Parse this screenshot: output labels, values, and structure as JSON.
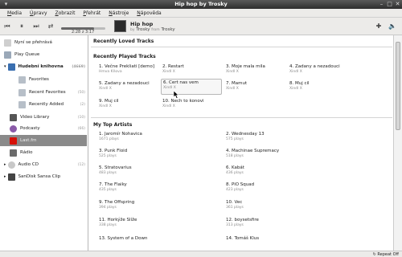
{
  "window": {
    "title": "Hip hop by Trosky"
  },
  "menu": [
    "Media",
    "Úpravy",
    "Zobrazit",
    "Přehrát",
    "Nástroje",
    "Nápověda"
  ],
  "player": {
    "time": "2:28 z 3:17",
    "progress": 0.75,
    "now_playing_title": "Hip hop",
    "now_playing_by": "by",
    "now_playing_artist": "Trosky",
    "now_playing_from": "from",
    "now_playing_album": "Trosky"
  },
  "sidebar": {
    "items": [
      {
        "label": "Nyní se přehrává",
        "count": ""
      },
      {
        "label": "Play Queue",
        "count": ""
      },
      {
        "label": "Hudební knihovna",
        "count": "(4669)"
      },
      {
        "label": "Favorites",
        "count": ""
      },
      {
        "label": "Recent Favorites",
        "count": "(50)"
      },
      {
        "label": "Recently Added",
        "count": "(2)"
      },
      {
        "label": "Video Library",
        "count": "(10)"
      },
      {
        "label": "Podcasty",
        "count": "(66)"
      },
      {
        "label": "Last.fm",
        "count": ""
      },
      {
        "label": "Rádio",
        "count": ""
      },
      {
        "label": "Audio CD",
        "count": "(12)"
      },
      {
        "label": "SanDisk Sansa Clip",
        "count": ""
      }
    ]
  },
  "main": {
    "sections": {
      "loved": "Recently Loved Tracks",
      "played": "Recently Played Tracks",
      "artists": "My Top Artists"
    },
    "played": [
      {
        "title": "1. Večne Prekliati [demo]",
        "artist": "Hmva Kňova"
      },
      {
        "title": "2. Restart",
        "artist": "Xindl X"
      },
      {
        "title": "3. Moje mala mila",
        "artist": "Xindl X"
      },
      {
        "title": "4. Zadany a nezadouci",
        "artist": "Xindl X"
      },
      {
        "title": "5. Zadany a nezadouci",
        "artist": "Xindl X"
      },
      {
        "title": "6. Cert nas vem",
        "artist": "Xindl X"
      },
      {
        "title": "7. Mamut",
        "artist": "Xindl X"
      },
      {
        "title": "8. Muj cil",
        "artist": "Xindl X"
      },
      {
        "title": "9. Muj cil",
        "artist": "Xindl X"
      },
      {
        "title": "10. Nech to konovi",
        "artist": "Xindl X"
      }
    ],
    "artists": [
      {
        "name": "1. Jaromír Nohavica",
        "plays": "1671 plays"
      },
      {
        "name": "2. Wednesday 13",
        "plays": "575 plays"
      },
      {
        "name": "3. Punk Floid",
        "plays": "525 plays"
      },
      {
        "name": "4. Machinae Supremacy",
        "plays": "518 plays"
      },
      {
        "name": "5. Stratovarius",
        "plays": "483 plays"
      },
      {
        "name": "6. Kabát",
        "plays": "436 plays"
      },
      {
        "name": "7. The Flaiky",
        "plays": "435 plays"
      },
      {
        "name": "8. PiO Squad",
        "plays": "423 plays"
      },
      {
        "name": "9. The Offspring",
        "plays": "394 plays"
      },
      {
        "name": "10. Vec",
        "plays": "361 plays"
      },
      {
        "name": "11. Horkýže Slíže",
        "plays": "338 plays"
      },
      {
        "name": "12. boysetsfire",
        "plays": "313 plays"
      },
      {
        "name": "13. System of a Down",
        "plays": ""
      },
      {
        "name": "14. Tomáš Klus",
        "plays": ""
      }
    ]
  },
  "status": {
    "repeat": "Repeat Off"
  }
}
